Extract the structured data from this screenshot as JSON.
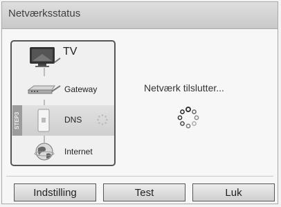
{
  "dialog": {
    "title": "Netværksstatus",
    "status_message": "Netværk tilslutter...",
    "steps": [
      {
        "label": "TV",
        "icon": "tv-icon"
      },
      {
        "label": "Gateway",
        "icon": "gateway-icon"
      },
      {
        "label": "DNS",
        "icon": "dns-server-icon",
        "tag": "STEP3",
        "active": true
      },
      {
        "label": "Internet",
        "icon": "globe-icon"
      }
    ],
    "buttons": {
      "settings": "Indstilling",
      "test": "Test",
      "close": "Luk"
    }
  }
}
